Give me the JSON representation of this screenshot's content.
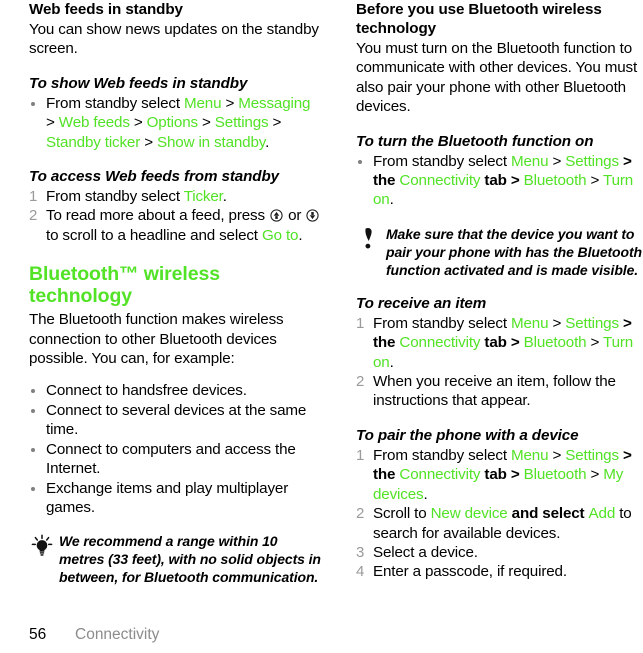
{
  "page": {
    "number": "56",
    "chapter": "Connectivity",
    "accent_green": "#52e226",
    "gray_marker": "#9a9a9a"
  },
  "left_column": {
    "heading": "Web feeds in standby",
    "intro": "You can show news updates on the standby screen.",
    "proc1": {
      "title": "To show Web feeds in standby",
      "step1": {
        "lead": "From standby select ",
        "t1": "Menu",
        "sep1": " > ",
        "t2": "Messaging",
        "sep2": " > ",
        "t3": "Web feeds",
        "sep3": " > ",
        "t4": "Options",
        "sep4": " > ",
        "t5": "Settings",
        "sep5": " > ",
        "t6": "Standby ticker",
        "sep6": " > ",
        "t7": "Show in standby",
        "end": "."
      }
    },
    "proc2": {
      "title": "To access Web feeds from standby",
      "num1": "1",
      "num2": "2",
      "step1_lead": "From standby select ",
      "step1_term": "Ticker",
      "step1_end": ".",
      "step2_a": "To read more about a feed, press ",
      "step2_icon_up": "nav-key-up-icon",
      "step2_b": " or ",
      "step2_icon_down": "nav-key-down-icon",
      "step2_c": " to scroll to a headline and select ",
      "step2_term": "Go to",
      "step2_end": "."
    },
    "bt_heading": "Bluetooth™ wireless technology",
    "bt_intro": "The Bluetooth function makes wireless connection to other Bluetooth devices possible. You can, for example:",
    "bt_bullets": [
      "Connect to handsfree devices.",
      "Connect to several devices at the same time.",
      "Connect to computers and access the Internet.",
      "Exchange items and play multiplayer games."
    ],
    "tip": {
      "icon": "lightbulb-tip-icon",
      "text": "We recommend a range within 10 metres (33 feet), with no solid objects in between, for Bluetooth communication."
    }
  },
  "right_column": {
    "heading": "Before you use Bluetooth wireless technology",
    "intro": "You must turn on the Bluetooth function to communicate with other devices. You must also pair your phone with other Bluetooth devices.",
    "proc_turn_on": {
      "title": "To turn the Bluetooth function on",
      "step1": {
        "lead": "From standby select ",
        "t1": "Menu",
        "sep1": " > ",
        "t2": "Settings",
        "sep2": " > the ",
        "t3": "Connectivity",
        "sep3": " tab > ",
        "t4": "Bluetooth",
        "sep4": " > ",
        "t5": "Turn on",
        "end": "."
      }
    },
    "note": {
      "icon": "exclamation-note-icon",
      "text": "Make sure that the device you want to pair your phone with has the Bluetooth function activated and is made visible."
    },
    "proc_receive": {
      "title": "To receive an item",
      "num1": "1",
      "num2": "2",
      "step1": {
        "lead": "From standby select ",
        "t1": "Menu",
        "sep1": " > ",
        "t2": "Settings",
        "sep2": " > the ",
        "t3": "Connectivity",
        "sep3": " tab > ",
        "t4": "Bluetooth",
        "sep4": " > ",
        "t5": "Turn on",
        "end": "."
      },
      "step2": "When you receive an item, follow the instructions that appear."
    },
    "proc_pair": {
      "title": "To pair the phone with a device",
      "num1": "1",
      "num2": "2",
      "num3": "3",
      "num4": "4",
      "step1": {
        "lead": "From standby select ",
        "t1": "Menu",
        "sep1": " > ",
        "t2": "Settings",
        "sep2": " > the ",
        "t3": "Connectivity",
        "sep3": " tab > ",
        "t4": "Bluetooth",
        "sep4": " > ",
        "t5": "My devices",
        "end": "."
      },
      "step2": {
        "lead": "Scroll to ",
        "t1": "New device",
        "mid": " and select ",
        "t2": "Add",
        "tail": " to search for available devices."
      },
      "step3": "Select a device.",
      "step4": "Enter a passcode, if required."
    }
  }
}
